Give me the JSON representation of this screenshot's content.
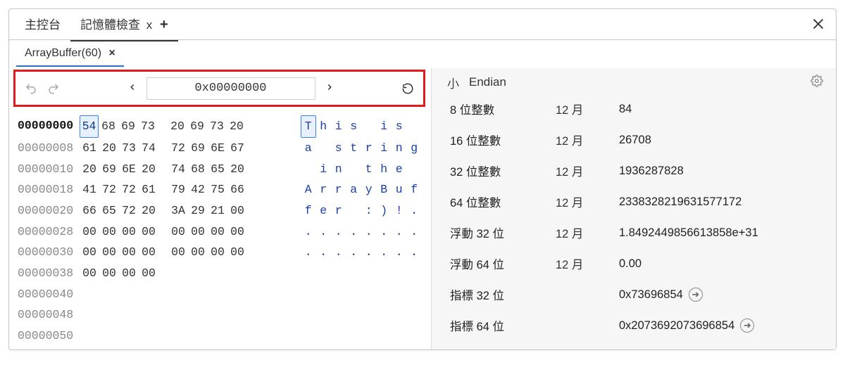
{
  "topTabs": {
    "console_label": "主控台",
    "memory_label": "記憶體檢查",
    "memory_close": "x",
    "add_tab": "+"
  },
  "subTab": {
    "label": "ArrayBuffer(60)"
  },
  "toolbar": {
    "address_value": "0x00000000",
    "prev": "<",
    "next": ">"
  },
  "hex_rows": [
    {
      "offset": "00000000",
      "bold": true,
      "bytes": [
        "54",
        "68",
        "69",
        "73",
        "20",
        "69",
        "73",
        "20"
      ],
      "ascii": [
        "T",
        "h",
        "i",
        "s",
        " ",
        "i",
        "s",
        " "
      ],
      "sel": 0
    },
    {
      "offset": "00000008",
      "bytes": [
        "61",
        "20",
        "73",
        "74",
        "72",
        "69",
        "6E",
        "67"
      ],
      "ascii": [
        "a",
        " ",
        "s",
        "t",
        "r",
        "i",
        "n",
        "g"
      ]
    },
    {
      "offset": "00000010",
      "bytes": [
        "20",
        "69",
        "6E",
        "20",
        "74",
        "68",
        "65",
        "20"
      ],
      "ascii": [
        " ",
        "i",
        "n",
        " ",
        "t",
        "h",
        "e",
        " "
      ]
    },
    {
      "offset": "00000018",
      "bytes": [
        "41",
        "72",
        "72",
        "61",
        "79",
        "42",
        "75",
        "66"
      ],
      "ascii": [
        "A",
        "r",
        "r",
        "a",
        "y",
        "B",
        "u",
        "f"
      ]
    },
    {
      "offset": "00000020",
      "bytes": [
        "66",
        "65",
        "72",
        "20",
        "3A",
        "29",
        "21",
        "00"
      ],
      "ascii": [
        "f",
        "e",
        "r",
        " ",
        ":",
        ")",
        "!",
        "."
      ]
    },
    {
      "offset": "00000028",
      "bytes": [
        "00",
        "00",
        "00",
        "00",
        "00",
        "00",
        "00",
        "00"
      ],
      "ascii": [
        ".",
        ".",
        ".",
        ".",
        ".",
        ".",
        ".",
        "."
      ]
    },
    {
      "offset": "00000030",
      "bytes": [
        "00",
        "00",
        "00",
        "00",
        "00",
        "00",
        "00",
        "00"
      ],
      "ascii": [
        ".",
        ".",
        ".",
        ".",
        ".",
        ".",
        ".",
        "."
      ]
    },
    {
      "offset": "00000038",
      "bytes": [
        "00",
        "00",
        "00",
        "00"
      ],
      "ascii": []
    },
    {
      "offset": "00000040",
      "bytes": [],
      "ascii": []
    },
    {
      "offset": "00000048",
      "bytes": [],
      "ascii": []
    },
    {
      "offset": "00000050",
      "bytes": [],
      "ascii": []
    }
  ],
  "right": {
    "endian_small": "小",
    "endian_label": "Endian",
    "rows": [
      {
        "label": "8 位整數",
        "mid": "12 月",
        "val": "84"
      },
      {
        "label": "16 位整數",
        "mid": "12 月",
        "val": "26708"
      },
      {
        "label": "32 位整數",
        "mid": "12 月",
        "val": "1936287828"
      },
      {
        "label": "64 位整數",
        "mid": "12 月",
        "val": "2338328219631577172"
      },
      {
        "label": "浮動 32 位",
        "mid": "12 月",
        "val": "1.8492449856613858e+31"
      },
      {
        "label": "浮動 64 位",
        "mid": "12 月",
        "val": "0.00"
      },
      {
        "label": "指標 32 位",
        "mid": "",
        "val": "0x73696854",
        "goto": true
      },
      {
        "label": "指標 64 位",
        "mid": "",
        "val": "0x2073692073696854",
        "goto": true
      }
    ]
  }
}
